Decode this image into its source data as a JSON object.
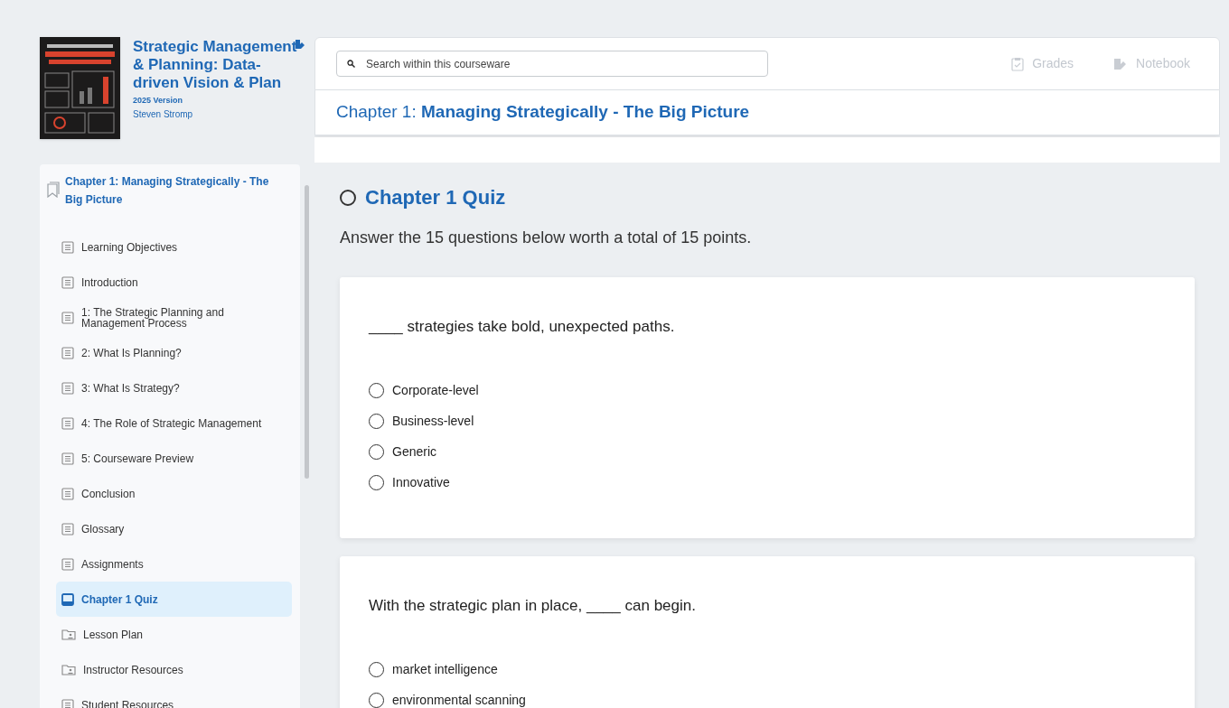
{
  "book": {
    "title": "Strategic Management & Planning: Data-driven Vision & Plan",
    "version": "2025 Version",
    "author": "Steven Stromp"
  },
  "chapter_nav": {
    "title": "Chapter 1: Managing Strategically - The Big Picture",
    "items": [
      {
        "label": "Learning Objectives",
        "kind": "page",
        "selected": false
      },
      {
        "label": "Introduction",
        "kind": "page",
        "selected": false
      },
      {
        "label": "1: The Strategic Planning and Management Process",
        "kind": "page",
        "selected": false
      },
      {
        "label": "2: What Is Planning?",
        "kind": "page",
        "selected": false
      },
      {
        "label": "3: What Is Strategy?",
        "kind": "page",
        "selected": false
      },
      {
        "label": "4: The Role of Strategic Management",
        "kind": "page",
        "selected": false
      },
      {
        "label": "5: Courseware Preview",
        "kind": "page",
        "selected": false
      },
      {
        "label": "Conclusion",
        "kind": "page",
        "selected": false
      },
      {
        "label": "Glossary",
        "kind": "page",
        "selected": false
      },
      {
        "label": "Assignments",
        "kind": "page",
        "selected": false
      },
      {
        "label": "Chapter 1 Quiz",
        "kind": "quiz",
        "selected": true
      },
      {
        "label": "Lesson Plan",
        "kind": "folder",
        "selected": false
      },
      {
        "label": "Instructor Resources",
        "kind": "folder",
        "selected": false
      },
      {
        "label": "Student Resources",
        "kind": "page",
        "selected": false
      }
    ]
  },
  "search": {
    "placeholder": "Search within this courseware"
  },
  "toolbar": [
    {
      "label": "Grades",
      "kind": "grades",
      "disabled": true
    },
    {
      "label": "Notebook",
      "kind": "notebook",
      "disabled": true
    }
  ],
  "chapter_header": {
    "prefix": "Chapter 1:",
    "title": "Managing Strategically - The Big Picture"
  },
  "quiz": {
    "title": "Chapter 1 Quiz",
    "completed": false,
    "instructions": "Answer the 15 questions below worth a total of 15 points.",
    "questions": [
      {
        "text": "____ strategies take bold, unexpected paths.",
        "options": [
          {
            "label": "Corporate-level",
            "selected": false
          },
          {
            "label": "Business-level",
            "selected": false
          },
          {
            "label": "Generic",
            "selected": false
          },
          {
            "label": "Innovative",
            "selected": false
          }
        ]
      },
      {
        "text": "With the strategic plan in place, ____ can begin.",
        "options": [
          {
            "label": "market intelligence",
            "selected": false
          },
          {
            "label": "environmental scanning",
            "selected": false
          }
        ]
      }
    ]
  }
}
